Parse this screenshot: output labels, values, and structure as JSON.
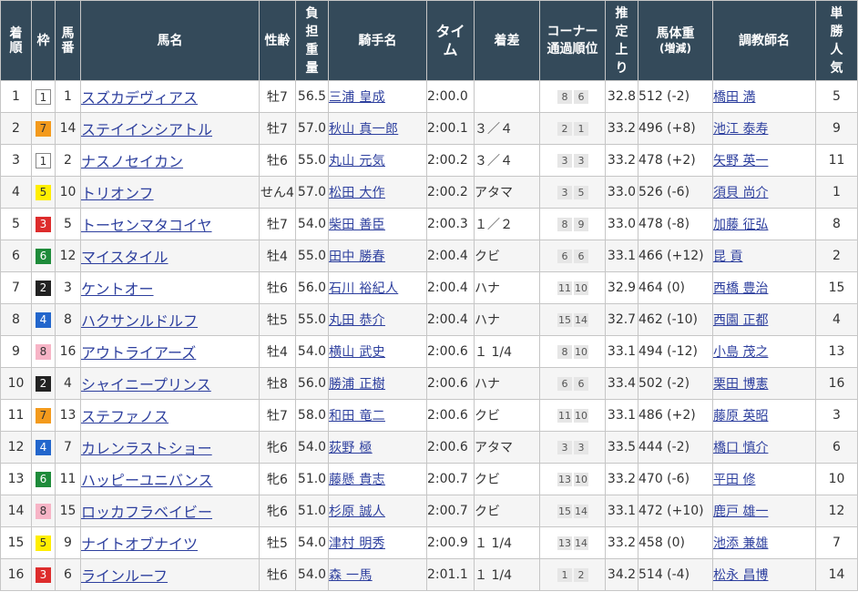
{
  "headers": {
    "rank": "着順",
    "waku": "枠",
    "umaban": "馬番",
    "horse": "馬名",
    "sexage": "性齢",
    "weight": "負担重量",
    "jockey": "騎手名",
    "time": "タイム",
    "margin": "着差",
    "corner": "コーナー通過順位",
    "last3f": "推定上り",
    "bodyweight": "馬体重(増減)",
    "trainer": "調教師名",
    "popularity": "単勝人気"
  },
  "colors": {
    "header_bg": "#344a5a",
    "link": "#2d3f9e",
    "waku": {
      "1": "#ffffff",
      "2": "#222222",
      "3": "#dd2c2c",
      "4": "#2266cc",
      "5": "#ffee00",
      "6": "#1e8b3a",
      "7": "#f39a1c",
      "8": "#f7b4c6"
    }
  },
  "rows": [
    {
      "rank": "1",
      "waku": "1",
      "umaban": "1",
      "horse": "スズカデヴィアス",
      "sexage": "牡7",
      "weight": "56.5",
      "jockey": "三浦 皇成",
      "time": "2:00.0",
      "margin": "",
      "corners": [
        "8",
        "6"
      ],
      "last3f": "32.8",
      "bodyweight": "512 (-2)",
      "trainer": "橋田 満",
      "popularity": "5"
    },
    {
      "rank": "2",
      "waku": "7",
      "umaban": "14",
      "horse": "ステイインシアトル",
      "sexage": "牡7",
      "weight": "57.0",
      "jockey": "秋山 真一郎",
      "time": "2:00.1",
      "margin": "３／４",
      "corners": [
        "2",
        "1"
      ],
      "last3f": "33.2",
      "bodyweight": "496 (+8)",
      "trainer": "池江 泰寿",
      "popularity": "9"
    },
    {
      "rank": "3",
      "waku": "1",
      "umaban": "2",
      "horse": "ナスノセイカン",
      "sexage": "牡6",
      "weight": "55.0",
      "jockey": "丸山 元気",
      "time": "2:00.2",
      "margin": "３／４",
      "corners": [
        "3",
        "3"
      ],
      "last3f": "33.2",
      "bodyweight": "478 (+2)",
      "trainer": "矢野 英一",
      "popularity": "11"
    },
    {
      "rank": "4",
      "waku": "5",
      "umaban": "10",
      "horse": "トリオンフ",
      "sexage": "せん4",
      "weight": "57.0",
      "jockey": "松田 大作",
      "time": "2:00.2",
      "margin": "アタマ",
      "corners": [
        "3",
        "5"
      ],
      "last3f": "33.0",
      "bodyweight": "526 (-6)",
      "trainer": "須貝 尚介",
      "popularity": "1"
    },
    {
      "rank": "5",
      "waku": "3",
      "umaban": "5",
      "horse": "トーセンマタコイヤ",
      "sexage": "牡7",
      "weight": "54.0",
      "jockey": "柴田 善臣",
      "time": "2:00.3",
      "margin": "１／２",
      "corners": [
        "8",
        "9"
      ],
      "last3f": "33.0",
      "bodyweight": "478 (-8)",
      "trainer": "加藤 征弘",
      "popularity": "8"
    },
    {
      "rank": "6",
      "waku": "6",
      "umaban": "12",
      "horse": "マイスタイル",
      "sexage": "牡4",
      "weight": "55.0",
      "jockey": "田中 勝春",
      "time": "2:00.4",
      "margin": "クビ",
      "corners": [
        "6",
        "6"
      ],
      "last3f": "33.1",
      "bodyweight": "466 (+12)",
      "trainer": "昆 貢",
      "popularity": "2"
    },
    {
      "rank": "7",
      "waku": "2",
      "umaban": "3",
      "horse": "ケントオー",
      "sexage": "牡6",
      "weight": "56.0",
      "jockey": "石川 裕紀人",
      "time": "2:00.4",
      "margin": "ハナ",
      "corners": [
        "11",
        "10"
      ],
      "last3f": "32.9",
      "bodyweight": "464 (0)",
      "trainer": "西橋 豊治",
      "popularity": "15"
    },
    {
      "rank": "8",
      "waku": "4",
      "umaban": "8",
      "horse": "ハクサンルドルフ",
      "sexage": "牡5",
      "weight": "55.0",
      "jockey": "丸田 恭介",
      "time": "2:00.4",
      "margin": "ハナ",
      "corners": [
        "15",
        "14"
      ],
      "last3f": "32.7",
      "bodyweight": "462 (-10)",
      "trainer": "西園 正都",
      "popularity": "4"
    },
    {
      "rank": "9",
      "waku": "8",
      "umaban": "16",
      "horse": "アウトライアーズ",
      "sexage": "牡4",
      "weight": "54.0",
      "jockey": "横山 武史",
      "time": "2:00.6",
      "margin": "１ 1/4",
      "corners": [
        "8",
        "10"
      ],
      "last3f": "33.1",
      "bodyweight": "494 (-12)",
      "trainer": "小島 茂之",
      "popularity": "13"
    },
    {
      "rank": "10",
      "waku": "2",
      "umaban": "4",
      "horse": "シャイニープリンス",
      "sexage": "牡8",
      "weight": "56.0",
      "jockey": "勝浦 正樹",
      "time": "2:00.6",
      "margin": "ハナ",
      "corners": [
        "6",
        "6"
      ],
      "last3f": "33.4",
      "bodyweight": "502 (-2)",
      "trainer": "栗田 博憲",
      "popularity": "16"
    },
    {
      "rank": "11",
      "waku": "7",
      "umaban": "13",
      "horse": "ステファノス",
      "sexage": "牡7",
      "weight": "58.0",
      "jockey": "和田 竜二",
      "time": "2:00.6",
      "margin": "クビ",
      "corners": [
        "11",
        "10"
      ],
      "last3f": "33.1",
      "bodyweight": "486 (+2)",
      "trainer": "藤原 英昭",
      "popularity": "3"
    },
    {
      "rank": "12",
      "waku": "4",
      "umaban": "7",
      "horse": "カレンラストショー",
      "sexage": "牝6",
      "weight": "54.0",
      "jockey": "荻野 極",
      "time": "2:00.6",
      "margin": "アタマ",
      "corners": [
        "3",
        "3"
      ],
      "last3f": "33.5",
      "bodyweight": "444 (-2)",
      "trainer": "橋口 慎介",
      "popularity": "6"
    },
    {
      "rank": "13",
      "waku": "6",
      "umaban": "11",
      "horse": "ハッピーユニバンス",
      "sexage": "牝6",
      "weight": "51.0",
      "jockey": "藤懸 貴志",
      "time": "2:00.7",
      "margin": "クビ",
      "corners": [
        "13",
        "10"
      ],
      "last3f": "33.2",
      "bodyweight": "470 (-6)",
      "trainer": "平田 修",
      "popularity": "10"
    },
    {
      "rank": "14",
      "waku": "8",
      "umaban": "15",
      "horse": "ロッカフラベイビー",
      "sexage": "牝6",
      "weight": "51.0",
      "jockey": "杉原 誠人",
      "time": "2:00.7",
      "margin": "クビ",
      "corners": [
        "15",
        "14"
      ],
      "last3f": "33.1",
      "bodyweight": "472 (+10)",
      "trainer": "鹿戸 雄一",
      "popularity": "12"
    },
    {
      "rank": "15",
      "waku": "5",
      "umaban": "9",
      "horse": "ナイトオブナイツ",
      "sexage": "牡5",
      "weight": "54.0",
      "jockey": "津村 明秀",
      "time": "2:00.9",
      "margin": "１ 1/4",
      "corners": [
        "13",
        "14"
      ],
      "last3f": "33.2",
      "bodyweight": "458 (0)",
      "trainer": "池添 兼雄",
      "popularity": "7"
    },
    {
      "rank": "16",
      "waku": "3",
      "umaban": "6",
      "horse": "ラインルーフ",
      "sexage": "牡6",
      "weight": "54.0",
      "jockey": "森 一馬",
      "time": "2:01.1",
      "margin": "１ 1/4",
      "corners": [
        "1",
        "2"
      ],
      "last3f": "34.2",
      "bodyweight": "514 (-4)",
      "trainer": "松永 昌博",
      "popularity": "14"
    }
  ]
}
